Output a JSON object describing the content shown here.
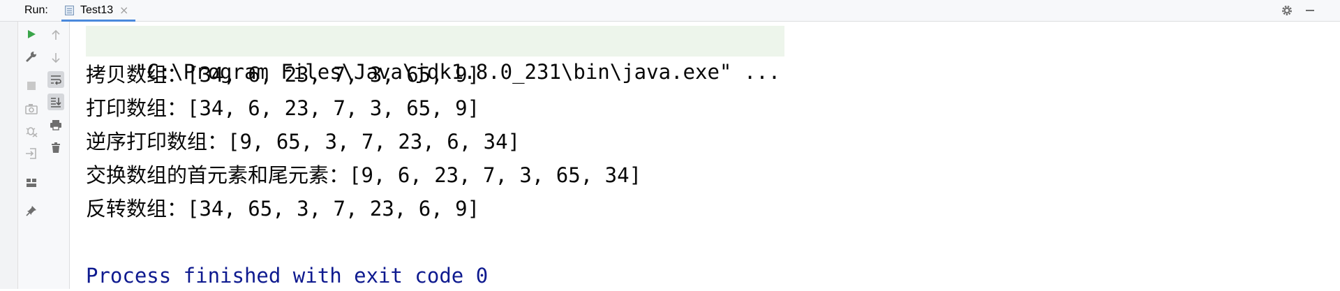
{
  "header": {
    "run_label": "Run:",
    "tab_label": "Test13",
    "tab_close": "×"
  },
  "icons": {
    "tab_file": "file-icon",
    "settings": "gear-icon",
    "minimize": "minimize-icon",
    "rerun": "run-icon",
    "modify": "wrench-icon",
    "stop": "stop-icon",
    "snapshot": "camera-icon",
    "debug_disabled": "debug-icon",
    "exit": "exit-icon",
    "layout": "layout-icon",
    "pin": "pin-icon",
    "up": "arrow-up-icon",
    "down": "arrow-down-icon",
    "soft_wrap": "soft-wrap-icon",
    "scroll_end": "scroll-to-end-icon",
    "print": "print-icon",
    "trash": "trash-icon"
  },
  "colors": {
    "run_green": "#3aa54a",
    "exit_blue": "#0e1a8f",
    "cmd_bg": "#edf5eb",
    "tab_underline": "#4a89dc"
  },
  "console": {
    "command": "\"C:\\Program Files\\Java\\jdk1.8.0_231\\bin\\java.exe\" ...",
    "lines": [
      "拷贝数组：[34, 6, 23, 7, 3, 65, 9]",
      "打印数组：[34, 6, 23, 7, 3, 65, 9]",
      "逆序打印数组：[9, 65, 3, 7, 23, 6, 34]",
      "交换数组的首元素和尾元素：[9, 6, 23, 7, 3, 65, 34]",
      "反转数组：[34, 65, 3, 7, 23, 6, 9]"
    ],
    "exit_message": "Process finished with exit code 0"
  }
}
